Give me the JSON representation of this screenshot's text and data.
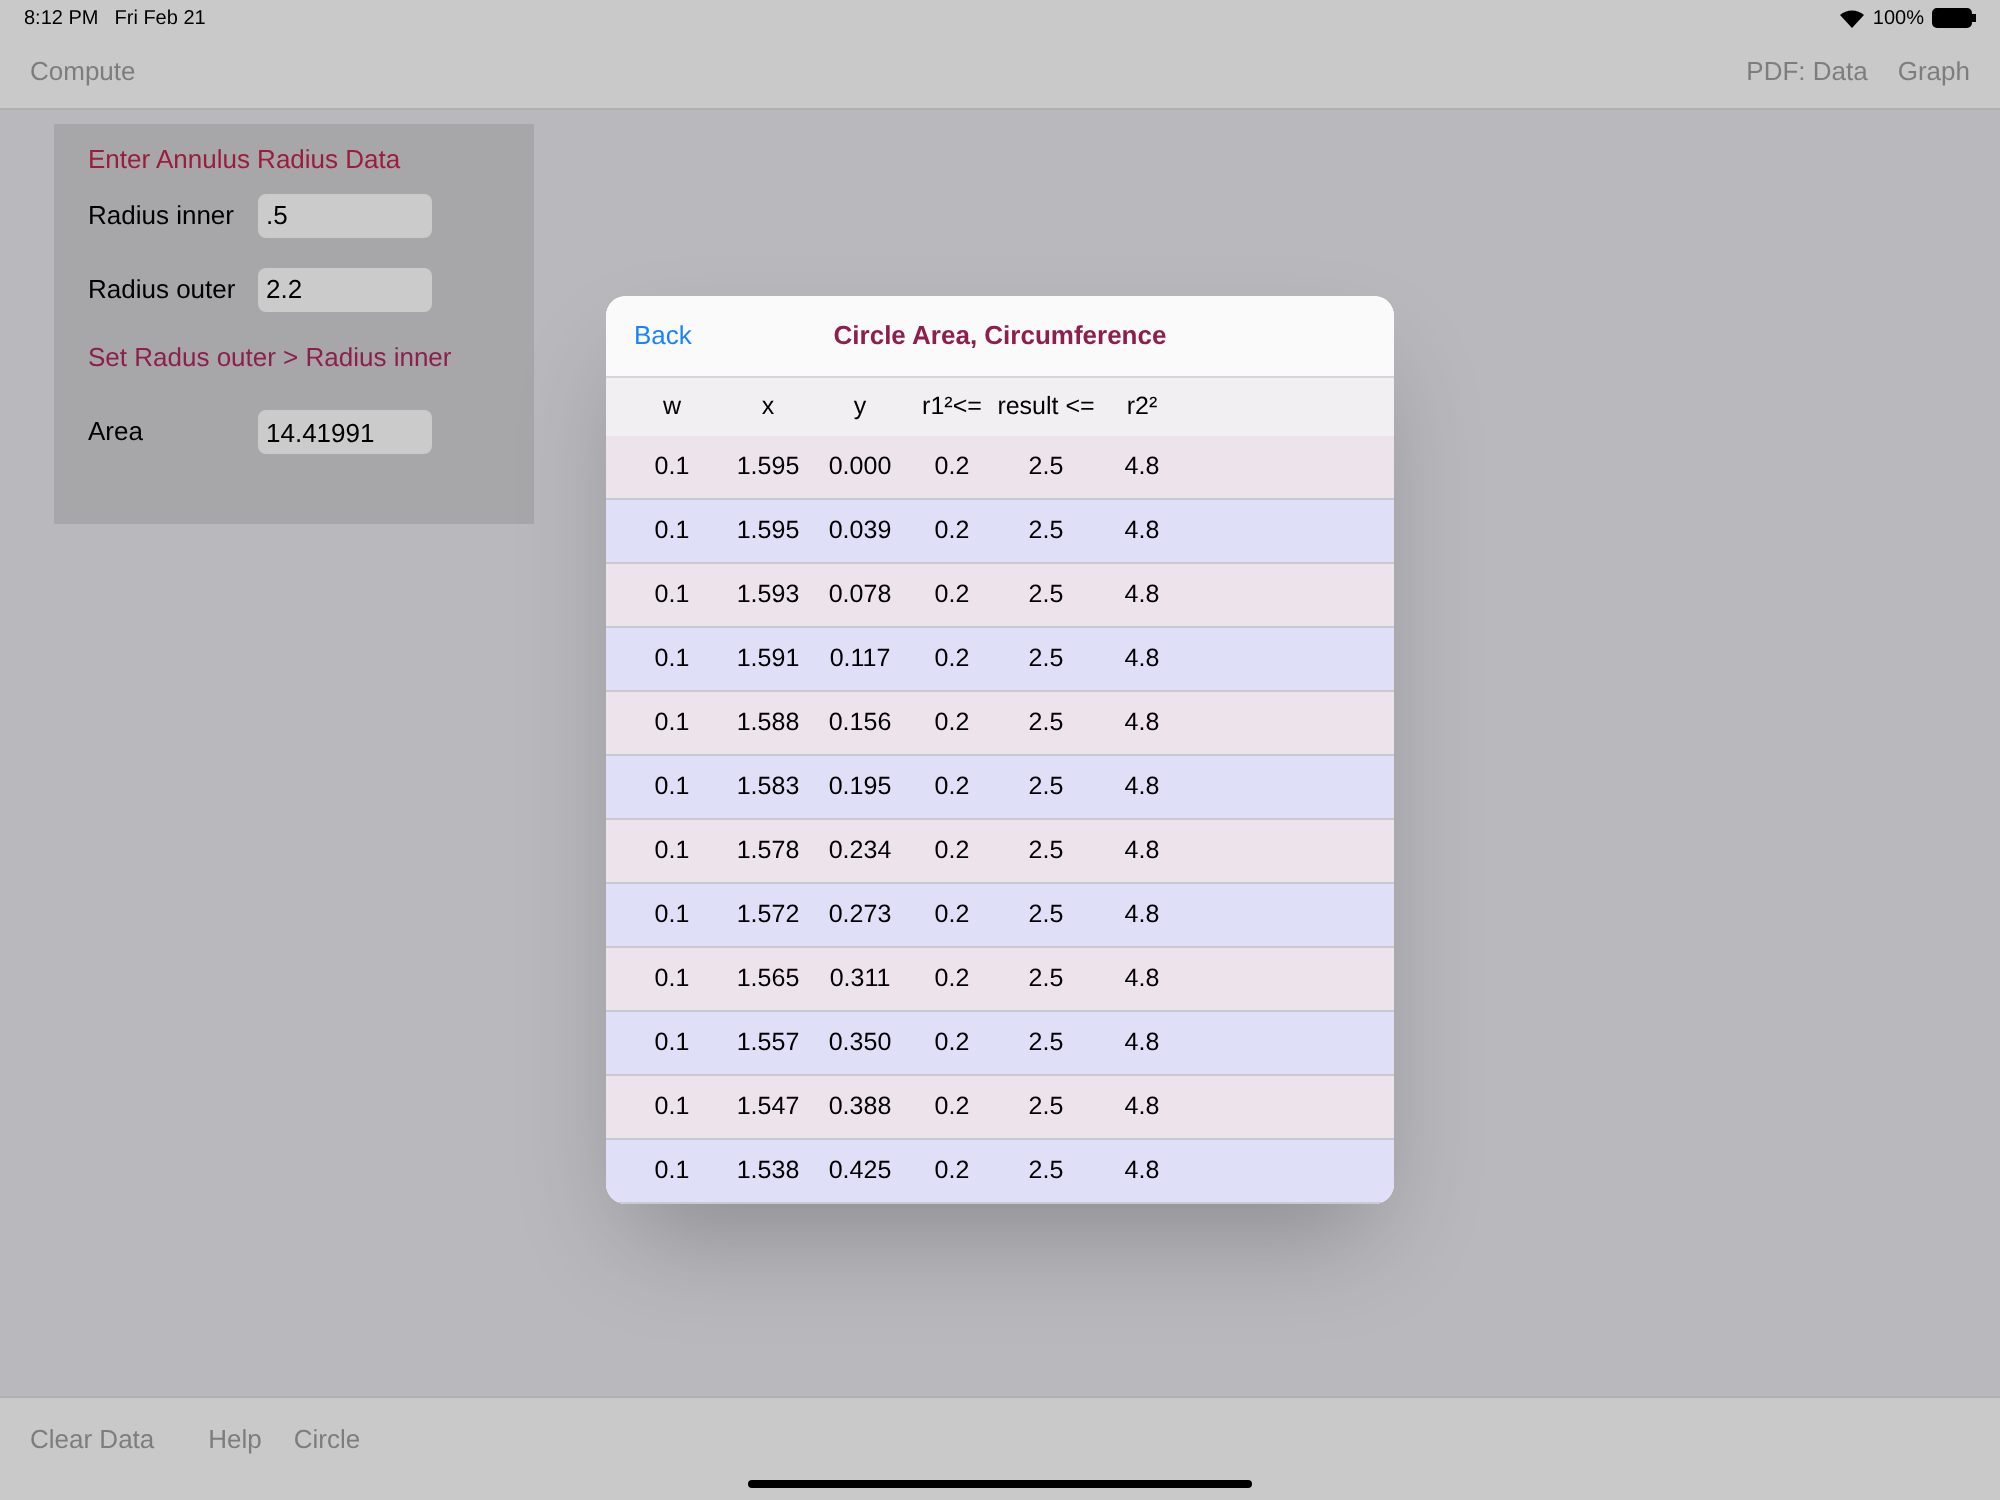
{
  "status_bar": {
    "time": "8:12 PM",
    "date": "Fri Feb 21",
    "battery": "100%"
  },
  "top_toolbar": {
    "left": [
      "Compute"
    ],
    "right": [
      "PDF: Data",
      "Graph"
    ]
  },
  "form": {
    "title": "Enter Annulus Radius Data",
    "fields": [
      {
        "label": "Radius inner",
        "value": ".5"
      },
      {
        "label": "Radius outer",
        "value": "2.2"
      }
    ],
    "hint": "Set Radus outer > Radius inner",
    "result": {
      "label": "Area",
      "value": "14.41991"
    }
  },
  "dialog": {
    "back": "Back",
    "title": "Circle Area, Circumference",
    "columns": [
      "w",
      "x",
      "y",
      "r1²<=",
      "result <=",
      "r2²"
    ],
    "rows": [
      [
        "0.1",
        "1.595",
        "0.000",
        "0.2",
        "2.5",
        "4.8"
      ],
      [
        "0.1",
        "1.595",
        "0.039",
        "0.2",
        "2.5",
        "4.8"
      ],
      [
        "0.1",
        "1.593",
        "0.078",
        "0.2",
        "2.5",
        "4.8"
      ],
      [
        "0.1",
        "1.591",
        "0.117",
        "0.2",
        "2.5",
        "4.8"
      ],
      [
        "0.1",
        "1.588",
        "0.156",
        "0.2",
        "2.5",
        "4.8"
      ],
      [
        "0.1",
        "1.583",
        "0.195",
        "0.2",
        "2.5",
        "4.8"
      ],
      [
        "0.1",
        "1.578",
        "0.234",
        "0.2",
        "2.5",
        "4.8"
      ],
      [
        "0.1",
        "1.572",
        "0.273",
        "0.2",
        "2.5",
        "4.8"
      ],
      [
        "0.1",
        "1.565",
        "0.311",
        "0.2",
        "2.5",
        "4.8"
      ],
      [
        "0.1",
        "1.557",
        "0.350",
        "0.2",
        "2.5",
        "4.8"
      ],
      [
        "0.1",
        "1.547",
        "0.388",
        "0.2",
        "2.5",
        "4.8"
      ],
      [
        "0.1",
        "1.538",
        "0.425",
        "0.2",
        "2.5",
        "4.8"
      ]
    ]
  },
  "bottom_toolbar": [
    "Clear Data",
    "Help",
    "Circle"
  ]
}
